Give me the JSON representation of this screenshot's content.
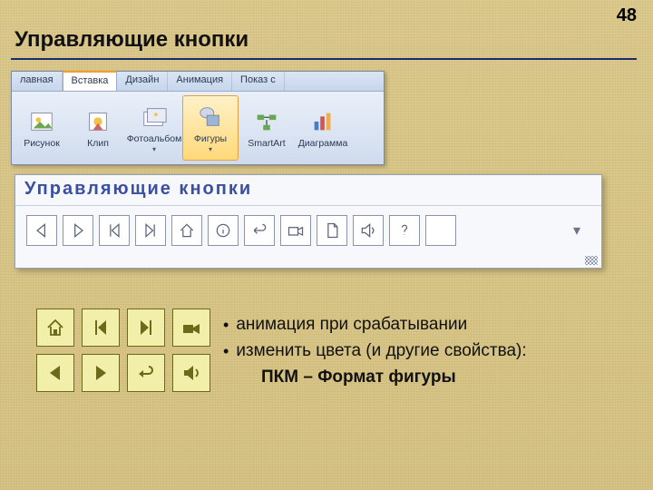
{
  "page_number": "48",
  "title": "Управляющие кнопки",
  "ribbon": {
    "tabs": [
      "лавная",
      "Вставка",
      "Дизайн",
      "Анимация",
      "Показ с"
    ],
    "active_index": 1,
    "items": [
      {
        "label": "Рисунок",
        "icon": "picture"
      },
      {
        "label": "Клип",
        "icon": "clip"
      },
      {
        "label": "Фотоальбом",
        "icon": "album"
      },
      {
        "label": "Фигуры",
        "icon": "shapes"
      },
      {
        "label": "SmartArt",
        "icon": "smartart"
      },
      {
        "label": "Диаграмма",
        "icon": "chart"
      }
    ],
    "selected_item_index": 3
  },
  "panel": {
    "title": "Управляющие кнопки",
    "buttons": [
      "back",
      "forward",
      "first",
      "last",
      "home",
      "info",
      "return",
      "movie",
      "document",
      "sound",
      "help",
      "blank"
    ]
  },
  "yellow_buttons": [
    "home",
    "first",
    "last",
    "movie",
    "back",
    "forward",
    "return",
    "sound"
  ],
  "bullets": {
    "items": [
      "анимация при срабатывании",
      "изменить цвета (и другие свойства):"
    ],
    "sub": "ПКМ – Формат фигуры"
  }
}
